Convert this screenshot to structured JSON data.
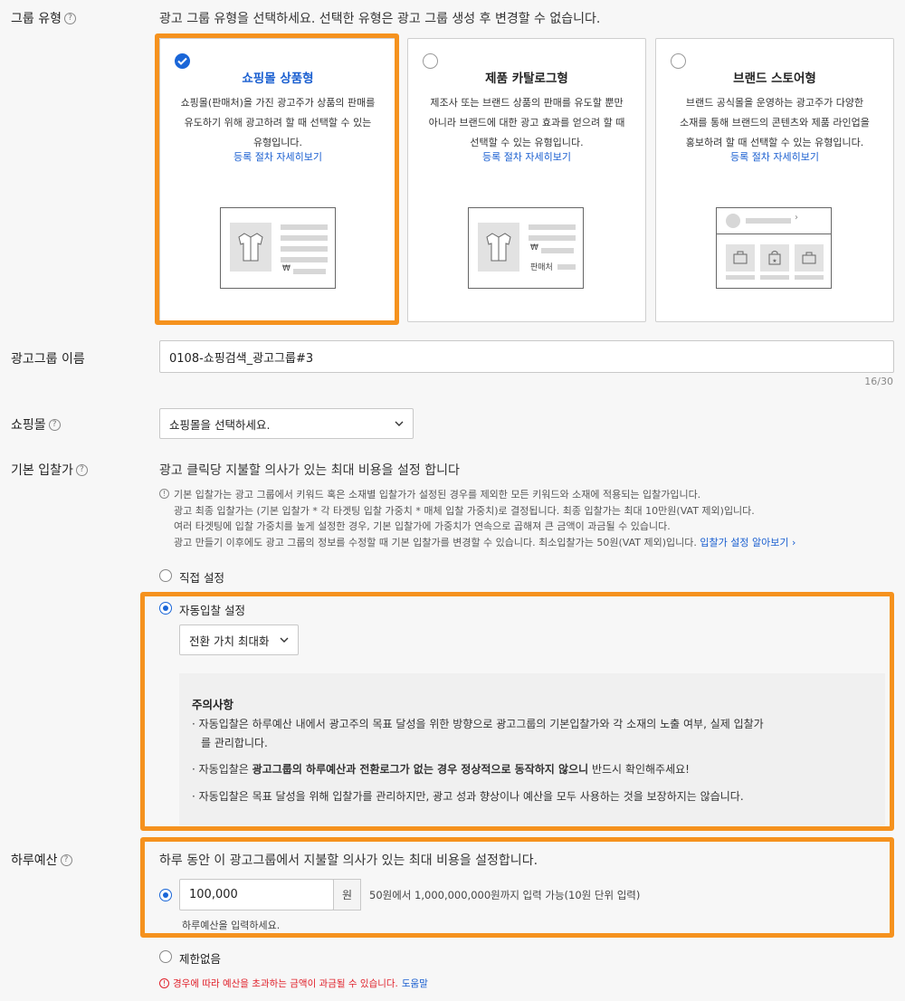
{
  "group_type": {
    "label": "그룹 유형",
    "help_icon": "?",
    "description": "광고 그룹 유형을 선택하세요. 선택한 유형은 광고 그룹 생성 후 변경할 수 없습니다.",
    "cards": [
      {
        "title": "쇼핑몰 상품형",
        "lines": [
          "쇼핑몰(판매처)을 가진 광고주가 상품의 판매를",
          "유도하기 위해 광고하려 할 때 선택할 수 있는",
          "유형입니다."
        ],
        "link": "등록 절차 자세히보기",
        "price_symbol": "₩",
        "selected": true
      },
      {
        "title": "제품 카탈로그형",
        "lines": [
          "제조사 또는 브랜드 상품의 판매를 유도할 뿐만",
          "아니라 브랜드에 대한 광고 효과를 얻으려 할 때",
          "선택할 수 있는 유형입니다."
        ],
        "link": "등록 절차 자세히보기",
        "price_symbol": "₩",
        "seller_label": "판매처",
        "selected": false
      },
      {
        "title": "브랜드 스토어형",
        "lines": [
          "브랜드 공식몰을 운영하는 광고주가 다양한",
          "소재를 통해 브랜드의 콘텐츠와 제품 라인업을",
          "홍보하려 할 때 선택할 수 있는 유형입니다."
        ],
        "link": "등록 절차 자세히보기",
        "selected": false
      }
    ]
  },
  "group_name": {
    "label": "광고그룹 이름",
    "value": "0108-쇼핑검색_광고그룹#3",
    "counter": "16/30"
  },
  "shopping_mall": {
    "label": "쇼핑몰",
    "placeholder": "쇼핑몰을 선택하세요."
  },
  "base_bid": {
    "label": "기본 입찰가",
    "description": "광고 클릭당 지불할 의사가 있는 최대 비용을 설정 합니다",
    "notice_lines": [
      "기본 입찰가는 광고 그룹에서 키워드 혹은 소재별 입찰가가 설정된 경우를 제외한 모든 키워드와 소재에 적용되는 입찰가입니다.",
      "광고 최종 입찰가는 (기본 입찰가 * 각 타겟팅 입찰 가중치 * 매체 입찰 가중치)로 결정됩니다. 최종 입찰가는 최대 10만원(VAT 제외)입니다.",
      "여러 타겟팅에 입찰 가중치를 높게 설정한 경우, 기본 입찰가에 가중치가 연속으로 곱해져 큰 금액이 과금될 수 있습니다.",
      "광고 만들기 이후에도 광고 그룹의 정보를 수정할 때 기본 입찰가를 변경할 수 있습니다. 최소입찰가는 50원(VAT 제외)입니다."
    ],
    "notice_link": "입찰가 설정 알아보기",
    "option_manual": "직접 설정",
    "option_auto": "자동입찰 설정",
    "auto_strategy": "전환 가치 최대화",
    "caution": {
      "title": "주의사항",
      "item1_line1": "자동입찰은 하루예산 내에서 광고주의 목표 달성을 위한 방향으로 광고그룹의 기본입찰가와 각 소재의 노출 여부, 실제 입찰가",
      "item1_line2": "를 관리합니다.",
      "item2_prefix": "자동입찰은 ",
      "item2_bold": "광고그룹의 하루예산과 전환로그가 없는 경우 정상적으로 동작하지 않으니",
      "item2_suffix": " 반드시 확인해주세요!",
      "item3": "자동입찰은 목표 달성을 위해 입찰가를 관리하지만, 광고 성과 향상이나 예산을 모두 사용하는 것을 보장하지는 않습니다."
    }
  },
  "daily_budget": {
    "label": "하루예산",
    "description": "하루 동안 이 광고그룹에서 지불할 의사가 있는 최대 비용을 설정합니다.",
    "value": "100,000",
    "unit": "원",
    "range_hint": "50원에서 1,000,000,000원까지 입력 가능(10원 단위 입력)",
    "input_hint": "하루예산을 입력하세요.",
    "option_unlimited": "제한없음",
    "warning": "경우에 따라 예산을 초과하는 금액이 과금될 수 있습니다.",
    "help_link": "도움말"
  },
  "colors": {
    "highlight": "#f5921e",
    "accent": "#1a66d8",
    "link": "#1a5fd0",
    "warning": "#e0202a"
  }
}
